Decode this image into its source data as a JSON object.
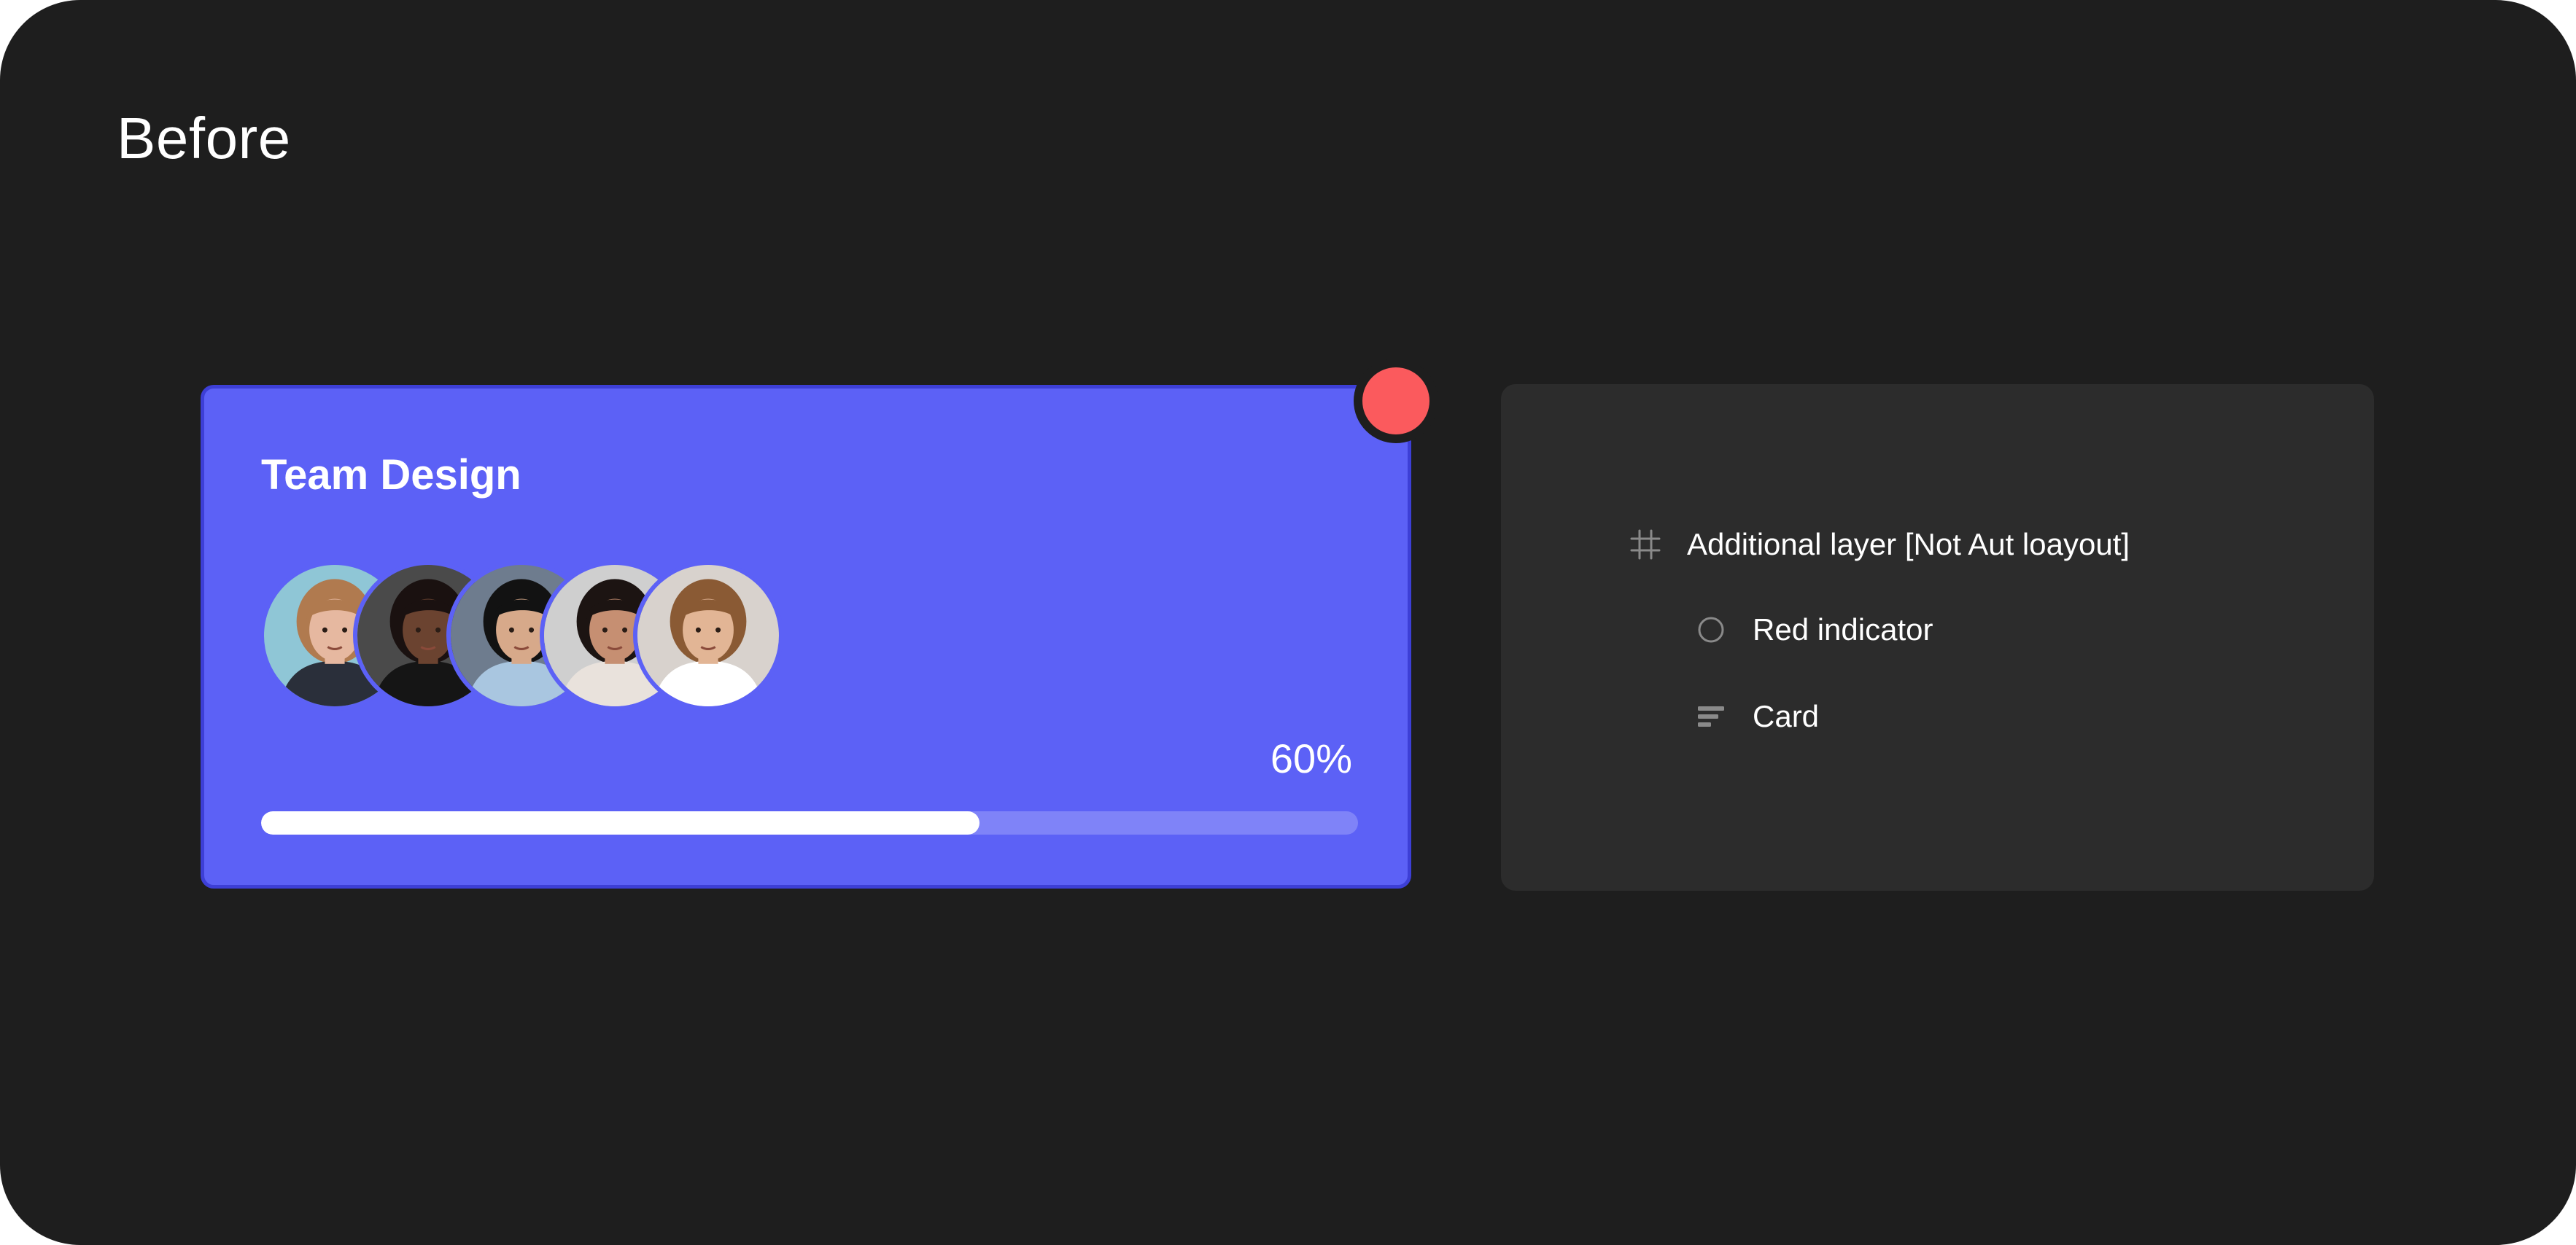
{
  "heading": "Before",
  "card": {
    "title": "Team Design",
    "avatars": [
      {
        "name": "avatar-person-1",
        "skin": "#e6b8a0",
        "hair": "#b07a4f",
        "bg": "#8fc6d6",
        "shirt": "#2a2f3a"
      },
      {
        "name": "avatar-person-2",
        "skin": "#6b4330",
        "hair": "#1a1110",
        "bg": "#4a4a4a",
        "shirt": "#151515"
      },
      {
        "name": "avatar-person-3",
        "skin": "#d7a98a",
        "hair": "#121212",
        "bg": "#6e7c8e",
        "shirt": "#a9c6e0"
      },
      {
        "name": "avatar-person-4",
        "skin": "#c68f72",
        "hair": "#1c1412",
        "bg": "#cfcfcf",
        "shirt": "#e9e2dc"
      },
      {
        "name": "avatar-person-5",
        "skin": "#e2b595",
        "hair": "#8a5a34",
        "bg": "#d8d2cd",
        "shirt": "#ffffff"
      }
    ],
    "progress": {
      "label": "60%",
      "fill_fraction": 0.655
    },
    "colors": {
      "background": "#5c61f6",
      "border": "#3d3fd6"
    }
  },
  "indicator": {
    "color": "#fb5a5d"
  },
  "layers": [
    {
      "icon": "frame-icon",
      "label": "Additional layer [Not Aut loayout]"
    },
    {
      "icon": "ellipse-icon",
      "label": "Red indicator"
    },
    {
      "icon": "autolayout-icon",
      "label": "Card"
    }
  ]
}
